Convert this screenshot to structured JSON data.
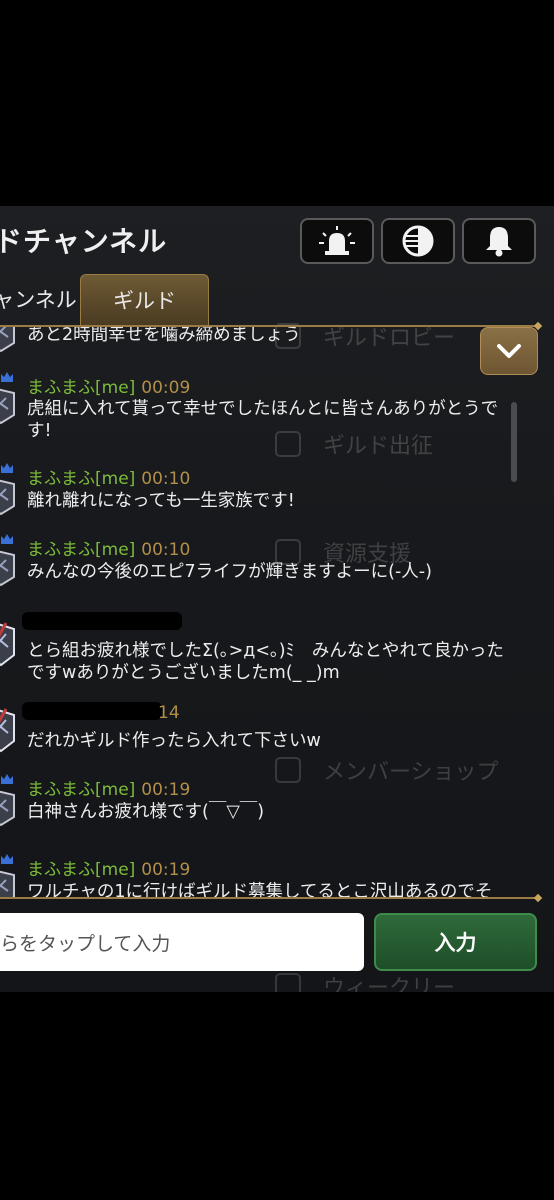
{
  "header": {
    "title": "ドチャンネル",
    "buttons": [
      {
        "name": "alert-siren-icon"
      },
      {
        "name": "language-toggle-icon"
      },
      {
        "name": "notification-bell-icon"
      }
    ]
  },
  "tabs": [
    {
      "label": "ャンネル",
      "active": false
    },
    {
      "label": "ギルド",
      "active": true
    }
  ],
  "background_menu": [
    {
      "label": "ギルドロビー"
    },
    {
      "label": "ギルド出征"
    },
    {
      "label": "資源支援"
    },
    {
      "label": "メンバーショップ"
    },
    {
      "label": "ウィークリー"
    }
  ],
  "messages": [
    {
      "user": "",
      "time": "",
      "text": "あと2時間幸せを噛み締めましょう",
      "redacted": false
    },
    {
      "user": "まふまふ[me]",
      "time": "00:09",
      "text": "虎組に入れて貰って幸せでしたほんとに皆さんありがとうです!",
      "redacted": false
    },
    {
      "user": "まふまふ[me]",
      "time": "00:10",
      "text": "離れ離れになっても一生家族です!",
      "redacted": false
    },
    {
      "user": "まふまふ[me]",
      "time": "00:10",
      "text": "みんなの今後のエピ7ライフが輝きますよーに(-人-)",
      "redacted": false
    },
    {
      "user": "",
      "time": "",
      "text": "とら組お疲れ様でしたΣ(｡>д<｡)ﾐ　みんなとやれて良かったですwありがとうございましたm(_ _)m",
      "redacted": true
    },
    {
      "user": "",
      "time": "14",
      "text": "だれかギルド作ったら入れて下さいw",
      "redacted": true
    },
    {
      "user": "まふまふ[me]",
      "time": "00:19",
      "text": "白神さんお疲れ様です(￣▽￣)",
      "redacted": false
    },
    {
      "user": "まふまふ[me]",
      "time": "00:19",
      "text": "ワルチャの1に行けばギルド募集してるとこ沢山あるのでそ",
      "redacted": false
    }
  ],
  "input": {
    "placeholder": "らをタップして入力",
    "send_label": "入力"
  },
  "colors": {
    "username": "#7dbd3a",
    "time": "#b28f48",
    "gold_accent": "#9a7b44",
    "send_button": "#2f6a3a"
  }
}
